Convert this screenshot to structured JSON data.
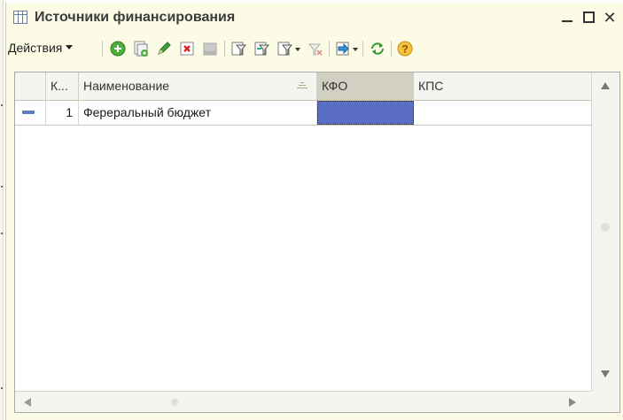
{
  "window": {
    "title": "Источники финансирования",
    "title_icon": "table-grid-icon",
    "minimize_icon": "minimize-icon",
    "maximize_icon": "maximize-icon",
    "close_glyph": "✕"
  },
  "toolbar": {
    "actions_label": "Действия",
    "buttons": [
      {
        "name": "add-button",
        "icon": "add-circle-icon"
      },
      {
        "name": "copy-button",
        "icon": "copy-document-icon"
      },
      {
        "name": "edit-button",
        "icon": "pencil-icon"
      },
      {
        "name": "delete-button",
        "icon": "delete-x-icon"
      },
      {
        "name": "finish-edit-button",
        "icon": "end-edit-icon",
        "disabled": true
      },
      {
        "name": "filter-button",
        "icon": "filter-icon"
      },
      {
        "name": "filter-by-value-button",
        "icon": "filter-by-value-icon"
      },
      {
        "name": "filter-history-button",
        "icon": "filter-history-icon"
      },
      {
        "name": "clear-filter-button",
        "icon": "clear-filter-icon",
        "disabled": true
      },
      {
        "name": "output-list-button",
        "icon": "output-list-icon"
      },
      {
        "name": "refresh-button",
        "icon": "refresh-icon"
      },
      {
        "name": "help-button",
        "icon": "help-icon"
      }
    ]
  },
  "table": {
    "columns": [
      "К...",
      "Наименование",
      "КФО",
      "КПС"
    ],
    "rows": [
      {
        "code": "1",
        "name": "Фереральный бюджет",
        "kfo": "",
        "kps": ""
      }
    ],
    "selected_color": "#5b6ec6"
  }
}
